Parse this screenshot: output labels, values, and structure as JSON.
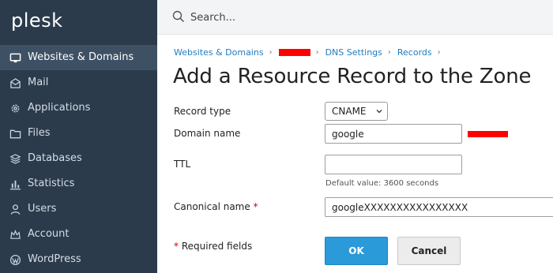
{
  "app": {
    "logo": "plesk"
  },
  "sidebar": {
    "items": [
      {
        "label": "Websites & Domains",
        "icon": "monitor-icon",
        "active": true
      },
      {
        "label": "Mail",
        "icon": "mail-icon",
        "active": false
      },
      {
        "label": "Applications",
        "icon": "gear-icon",
        "active": false
      },
      {
        "label": "Files",
        "icon": "folder-icon",
        "active": false
      },
      {
        "label": "Databases",
        "icon": "database-icon",
        "active": false
      },
      {
        "label": "Statistics",
        "icon": "bar-chart-icon",
        "active": false
      },
      {
        "label": "Users",
        "icon": "user-icon",
        "active": false
      },
      {
        "label": "Account",
        "icon": "account-icon",
        "active": false
      },
      {
        "label": "WordPress",
        "icon": "wordpress-icon",
        "active": false
      }
    ]
  },
  "search": {
    "placeholder": "Search..."
  },
  "breadcrumb": {
    "items": [
      "Websites & Domains",
      "DNS Settings",
      "Records"
    ]
  },
  "page": {
    "title": "Add a Resource Record to the Zone"
  },
  "form": {
    "record_type_label": "Record type",
    "record_type_value": "CNAME",
    "domain_name_label": "Domain name",
    "domain_name_value": "google",
    "ttl_label": "TTL",
    "ttl_value": "",
    "ttl_hint": "Default value: 3600 seconds",
    "canonical_name_label": "Canonical name",
    "canonical_name_value": "googleXXXXXXXXXXXXXXXX",
    "required_star": "*",
    "required_fields_label": "Required fields"
  },
  "buttons": {
    "ok_label": "OK",
    "cancel_label": "Cancel"
  },
  "colors": {
    "sidebar_bg": "#2b3b4c",
    "sidebar_active": "#3e5064",
    "link": "#1f7cc0",
    "primary_button": "#2a9ad9",
    "redaction": "#ff0000"
  }
}
